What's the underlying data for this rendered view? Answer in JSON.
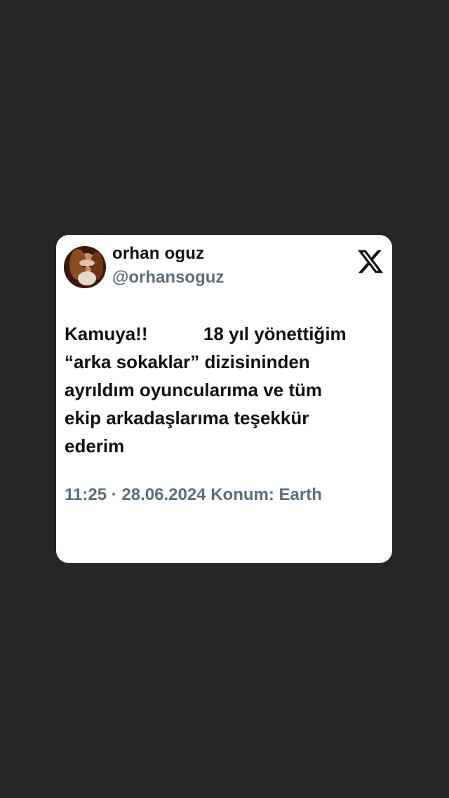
{
  "tweet": {
    "author_name": "orhan oguz",
    "author_handle": "@orhansoguz",
    "avatar_icon": "profile-photo",
    "platform_icon": "x-logo-icon",
    "text": "Kamuya!!           18 yıl yönettiğim\n“arka sokaklar” dizisininden\nayrıldım oyuncularıma ve tüm\nekip arkadaşlarıma teşekkür\nederim",
    "time": "11:25",
    "separator": "·",
    "date": "28.06.2024",
    "location_label": "Konum:",
    "location": "Earth"
  },
  "colors": {
    "background": "#252525",
    "card": "#ffffff",
    "text": "#111111",
    "muted": "#5b6e7d"
  }
}
